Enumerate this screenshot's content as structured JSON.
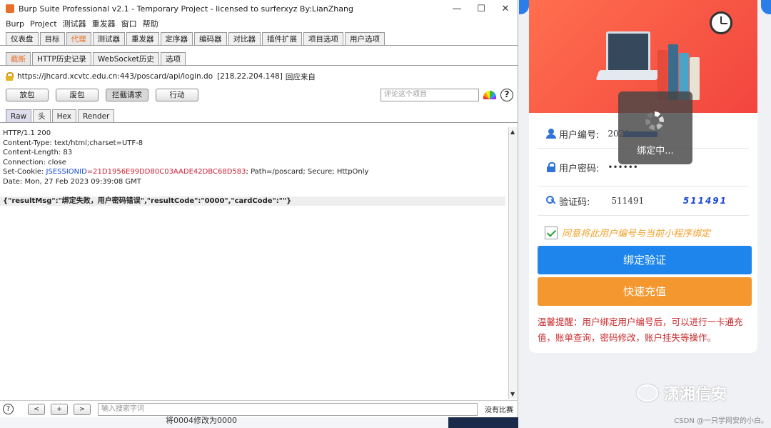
{
  "burp": {
    "title": "Burp Suite Professional v2.1 - Temporary Project - licensed to surferxyz By:LianZhang",
    "window_controls": {
      "minimize": "—",
      "maximize": "☐",
      "close": "✕"
    },
    "menu": [
      "Burp",
      "Project",
      "测试器",
      "重发器",
      "窗口",
      "帮助"
    ],
    "main_tabs": [
      "仪表盘",
      "目标",
      "代理",
      "测试器",
      "重发器",
      "定序器",
      "编码器",
      "对比器",
      "插件扩展",
      "项目选项",
      "用户选项"
    ],
    "proxy_tabs": [
      "截断",
      "HTTP历史记录",
      "WebSocket历史",
      "选项"
    ],
    "url": "https://jhcard.xcvtc.edu.cn:443/poscard/api/login.do",
    "ip": "[218.22.204.148]",
    "direction": "回应来自",
    "buttons": {
      "forward": "放包",
      "drop": "废包",
      "intercept": "拦截请求",
      "action": "行动"
    },
    "comment_placeholder": "评论这个项目",
    "view_tabs": [
      "Raw",
      "头",
      "Hex",
      "Render"
    ],
    "response": {
      "status": "HTTP/1.1 200",
      "content_type": "Content-Type: text/html;charset=UTF-8",
      "content_length": "Content-Length: 83",
      "connection": "Connection: close",
      "cookie_prefix": "Set-Cookie: ",
      "cookie_key": "JSESSIONID",
      "cookie_val": "=21D1956E99DD80C03AADE42DBC68D583",
      "cookie_suffix": "; Path=/poscard; Secure; HttpOnly",
      "date": "Date: Mon, 27 Feb 2023 09:39:08 GMT",
      "body": "{\"resultMsg\":\"绑定失败，用户密码错误\",\"resultCode\":\"0000\",\"cardCode\":\"\"}"
    },
    "bottom": {
      "help": "?",
      "prev": "<",
      "add": "+",
      "next": ">",
      "search_placeholder": "输入搜索字词",
      "match_count": "没有比赛"
    },
    "caption": "将0004修改为0000"
  },
  "phone": {
    "user_label": "用户编号:",
    "user_value": "2021",
    "password_label": "用户密码:",
    "password_value": "••••••",
    "captcha_label": "验证码:",
    "captcha_value": "511491",
    "captcha_image_text": "511491",
    "agree_text": "同意将此用户编号与当前小程序绑定",
    "bind_button": "绑定验证",
    "recharge_button": "快速充值",
    "tip": "温馨提醒：用户绑定用户编号后，可以进行一卡通充值，账单查询，密码修改，账户挂失等操作。",
    "toast": "绑定中...",
    "watermark": "潇湘信安",
    "csdn": "CSDN @一只学网安的小白。"
  }
}
